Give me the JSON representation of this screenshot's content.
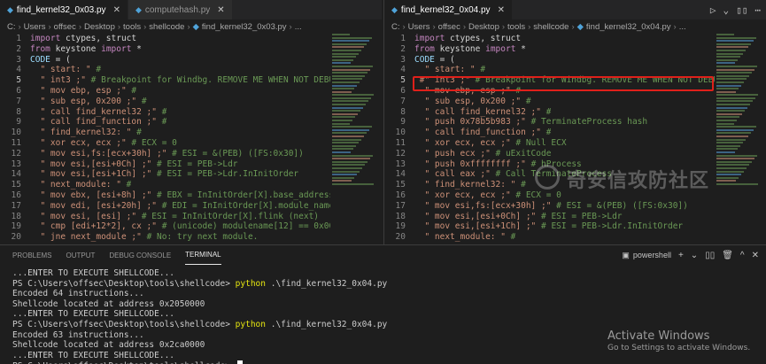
{
  "colors": {
    "accent_highlight": "#e0201a",
    "command": "#e5e510",
    "background": "#1e1e1e"
  },
  "left": {
    "tabs": [
      {
        "label": "find_kernel32_0x03.py",
        "active": true
      },
      {
        "label": "computehash.py",
        "active": false
      }
    ],
    "breadcrumb": [
      "C:",
      "Users",
      "offsec",
      "Desktop",
      "tools",
      "shellcode",
      "find_kernel32_0x03.py",
      "..."
    ],
    "lines": [
      {
        "n": "1",
        "t": "import ctypes, struct"
      },
      {
        "n": "2",
        "t": "from keystone import *"
      },
      {
        "n": "3",
        "t": "CODE = ("
      },
      {
        "n": "4",
        "t": "  \" start: \" #"
      },
      {
        "n": "5",
        "t": "  \" int3 ;\" # Breakpoint for Windbg. REMOVE ME WHEN NOT DEBUGGING!!!!"
      },
      {
        "n": "6",
        "t": "  \" mov ebp, esp ;\" #"
      },
      {
        "n": "7",
        "t": "  \" sub esp, 0x200 ;\" #"
      },
      {
        "n": "8",
        "t": "  \" call find_kernel32 ;\" #"
      },
      {
        "n": "9",
        "t": "  \" call find_function ;\" #"
      },
      {
        "n": "10",
        "t": "  \" find_kernel32: \" #"
      },
      {
        "n": "11",
        "t": "  \" xor ecx, ecx ;\" # ECX = 0"
      },
      {
        "n": "12",
        "t": "  \" mov esi,fs:[ecx+30h] ;\" # ESI = &(PEB) ([FS:0x30])"
      },
      {
        "n": "13",
        "t": "  \" mov esi,[esi+0Ch] ;\" # ESI = PEB->Ldr"
      },
      {
        "n": "14",
        "t": "  \" mov esi,[esi+1Ch] ;\" # ESI = PEB->Ldr.InInitOrder"
      },
      {
        "n": "15",
        "t": "  \" next_module: \" #"
      },
      {
        "n": "16",
        "t": "  \" mov ebx, [esi+8h] ;\" # EBX = InInitOrder[X].base_address"
      },
      {
        "n": "17",
        "t": "  \" mov edi, [esi+20h] ;\" # EDI = InInitOrder[X].module_name"
      },
      {
        "n": "18",
        "t": "  \" mov esi, [esi] ;\" # ESI = InInitOrder[X].flink (next)"
      },
      {
        "n": "19",
        "t": "  \" cmp [edi+12*2], cx ;\" # (unicode) modulename[12] == 0x00?"
      },
      {
        "n": "20",
        "t": "  \" jne next_module ;\" # No: try next module."
      }
    ]
  },
  "right": {
    "tabs": [
      {
        "label": "find_kernel32_0x04.py",
        "active": true
      }
    ],
    "breadcrumb": [
      "C:",
      "Users",
      "offsec",
      "Desktop",
      "tools",
      "shellcode",
      "find_kernel32_0x04.py",
      "..."
    ],
    "lines": [
      {
        "n": "1",
        "t": "import ctypes, struct"
      },
      {
        "n": "2",
        "t": "from keystone import *"
      },
      {
        "n": "3",
        "t": "CODE = ("
      },
      {
        "n": "4",
        "t": "  \" start: \" #"
      },
      {
        "n": "5",
        "t": " #\" int3 ;\" # Breakpoint for Windbg. REMOVE ME WHEN NOT DEBUGGING!!!!"
      },
      {
        "n": "6",
        "t": "  \" mov ebp, esp ;\" #"
      },
      {
        "n": "7",
        "t": "  \" sub esp, 0x200 ;\" #"
      },
      {
        "n": "8",
        "t": "  \" call find_kernel32 ;\" #"
      },
      {
        "n": "9",
        "t": "  \" push 0x78b5b983 ;\" # TerminateProcess hash"
      },
      {
        "n": "10",
        "t": "  \" call find_function ;\" #"
      },
      {
        "n": "11",
        "t": "  \" xor ecx, ecx ;\" # Null ECX"
      },
      {
        "n": "12",
        "t": "  \" push ecx ;\" # uExitCode"
      },
      {
        "n": "13",
        "t": "  \" push 0xffffffff ;\" # hProcess"
      },
      {
        "n": "14",
        "t": "  \" call eax ;\" # Call TerminateProcess"
      },
      {
        "n": "15",
        "t": "  \" find_kernel32: \" #"
      },
      {
        "n": "16",
        "t": "  \" xor ecx, ecx ;\" # ECX = 0"
      },
      {
        "n": "17",
        "t": "  \" mov esi,fs:[ecx+30h] ;\" # ESI = &(PEB) ([FS:0x30])"
      },
      {
        "n": "18",
        "t": "  \" mov esi,[esi+0Ch] ;\" # ESI = PEB->Ldr"
      },
      {
        "n": "19",
        "t": "  \" mov esi,[esi+1Ch] ;\" # ESI = PEB->Ldr.InInitOrder"
      },
      {
        "n": "20",
        "t": "  \" next_module: \" #"
      }
    ]
  },
  "panel": {
    "tabs": [
      "PROBLEMS",
      "OUTPUT",
      "DEBUG CONSOLE",
      "TERMINAL"
    ],
    "active_tab": "TERMINAL",
    "shell": "powershell",
    "terminal": [
      {
        "t": "...ENTER TO EXECUTE SHELLCODE..."
      },
      {
        "p": "PS C:\\Users\\offsec\\Desktop\\tools\\shellcode> ",
        "c": "python",
        "a": " .\\find_kernel32_0x04.py"
      },
      {
        "t": "Encoded 64 instructions..."
      },
      {
        "t": "Shellcode located at address 0x2050000"
      },
      {
        "t": "...ENTER TO EXECUTE SHELLCODE..."
      },
      {
        "p": "PS C:\\Users\\offsec\\Desktop\\tools\\shellcode> ",
        "c": "python",
        "a": " .\\find_kernel32_0x04.py"
      },
      {
        "t": "Encoded 63 instructions..."
      },
      {
        "t": "Shellcode located at address 0x2ca0000"
      },
      {
        "t": "...ENTER TO EXECUTE SHELLCODE..."
      },
      {
        "p": "PS C:\\Users\\offsec\\Desktop\\tools\\shellcode> ",
        "cursor": true
      }
    ]
  },
  "watermark": "奇安信攻防社区",
  "activation": {
    "title": "Activate Windows",
    "subtitle": "Go to Settings to activate Windows."
  }
}
